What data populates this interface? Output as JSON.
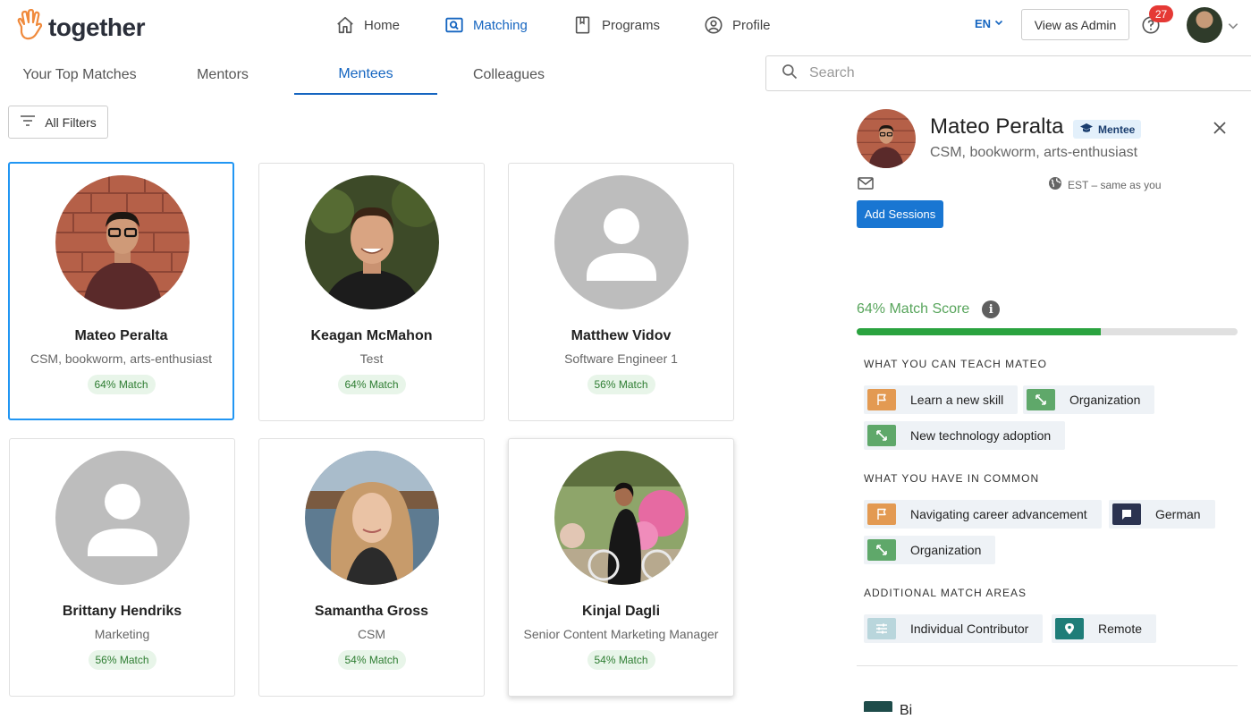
{
  "app": {
    "logo_text": "together"
  },
  "nav": {
    "home": "Home",
    "matching": "Matching",
    "programs": "Programs",
    "profile": "Profile"
  },
  "header": {
    "language": "EN",
    "view_as_admin": "View as Admin",
    "notification_count": "27"
  },
  "tabs": [
    "Your Top Matches",
    "Mentors",
    "Mentees",
    "Colleagues"
  ],
  "active_tab": "Mentees",
  "search": {
    "placeholder": "Search"
  },
  "filters": {
    "label": "All Filters"
  },
  "cards": [
    {
      "name": "Mateo Peralta",
      "title": "CSM, bookworm, arts-enthusiast",
      "match": "64% Match"
    },
    {
      "name": "Keagan McMahon",
      "title": "Test",
      "match": "64% Match"
    },
    {
      "name": "Matthew Vidov",
      "title": "Software Engineer 1",
      "match": "56% Match"
    },
    {
      "name": "Brittany Hendriks",
      "title": "Marketing",
      "match": "56% Match"
    },
    {
      "name": "Samantha Gross",
      "title": "CSM",
      "match": "54% Match"
    },
    {
      "name": "Kinjal Dagli",
      "title": "Senior Content Marketing Manager",
      "match": "54% Match"
    }
  ],
  "panel": {
    "name": "Mateo Peralta",
    "role_badge": "Mentee",
    "subtitle": "CSM, bookworm, arts-enthusiast",
    "timezone": "EST – same as you",
    "add_sessions": "Add Sessions",
    "match_score_label": "64% Match Score",
    "match_score_fraction": 0.64,
    "info_glyph": "i",
    "teach_heading": "WHAT YOU CAN TEACH MATEO",
    "teach_chips": [
      "Learn a new skill",
      "Organization",
      "New technology adoption"
    ],
    "common_heading": "WHAT YOU HAVE IN COMMON",
    "common_chips": [
      "Navigating career advancement",
      "German",
      "Organization"
    ],
    "additional_heading": "ADDITIONAL MATCH AREAS",
    "additional_chips": [
      "Individual Contributor",
      "Remote"
    ],
    "peek_text": "Bi"
  },
  "colors": {
    "accent": "#1565c0",
    "selected_border": "#2196f3",
    "match_green": "#2aa33f",
    "chip_orange": "#e39a52",
    "chip_green": "#5fa86a",
    "chip_navy": "#2b3350",
    "chip_lightblue": "#b9d6dc",
    "chip_teal": "#1f7d78"
  }
}
